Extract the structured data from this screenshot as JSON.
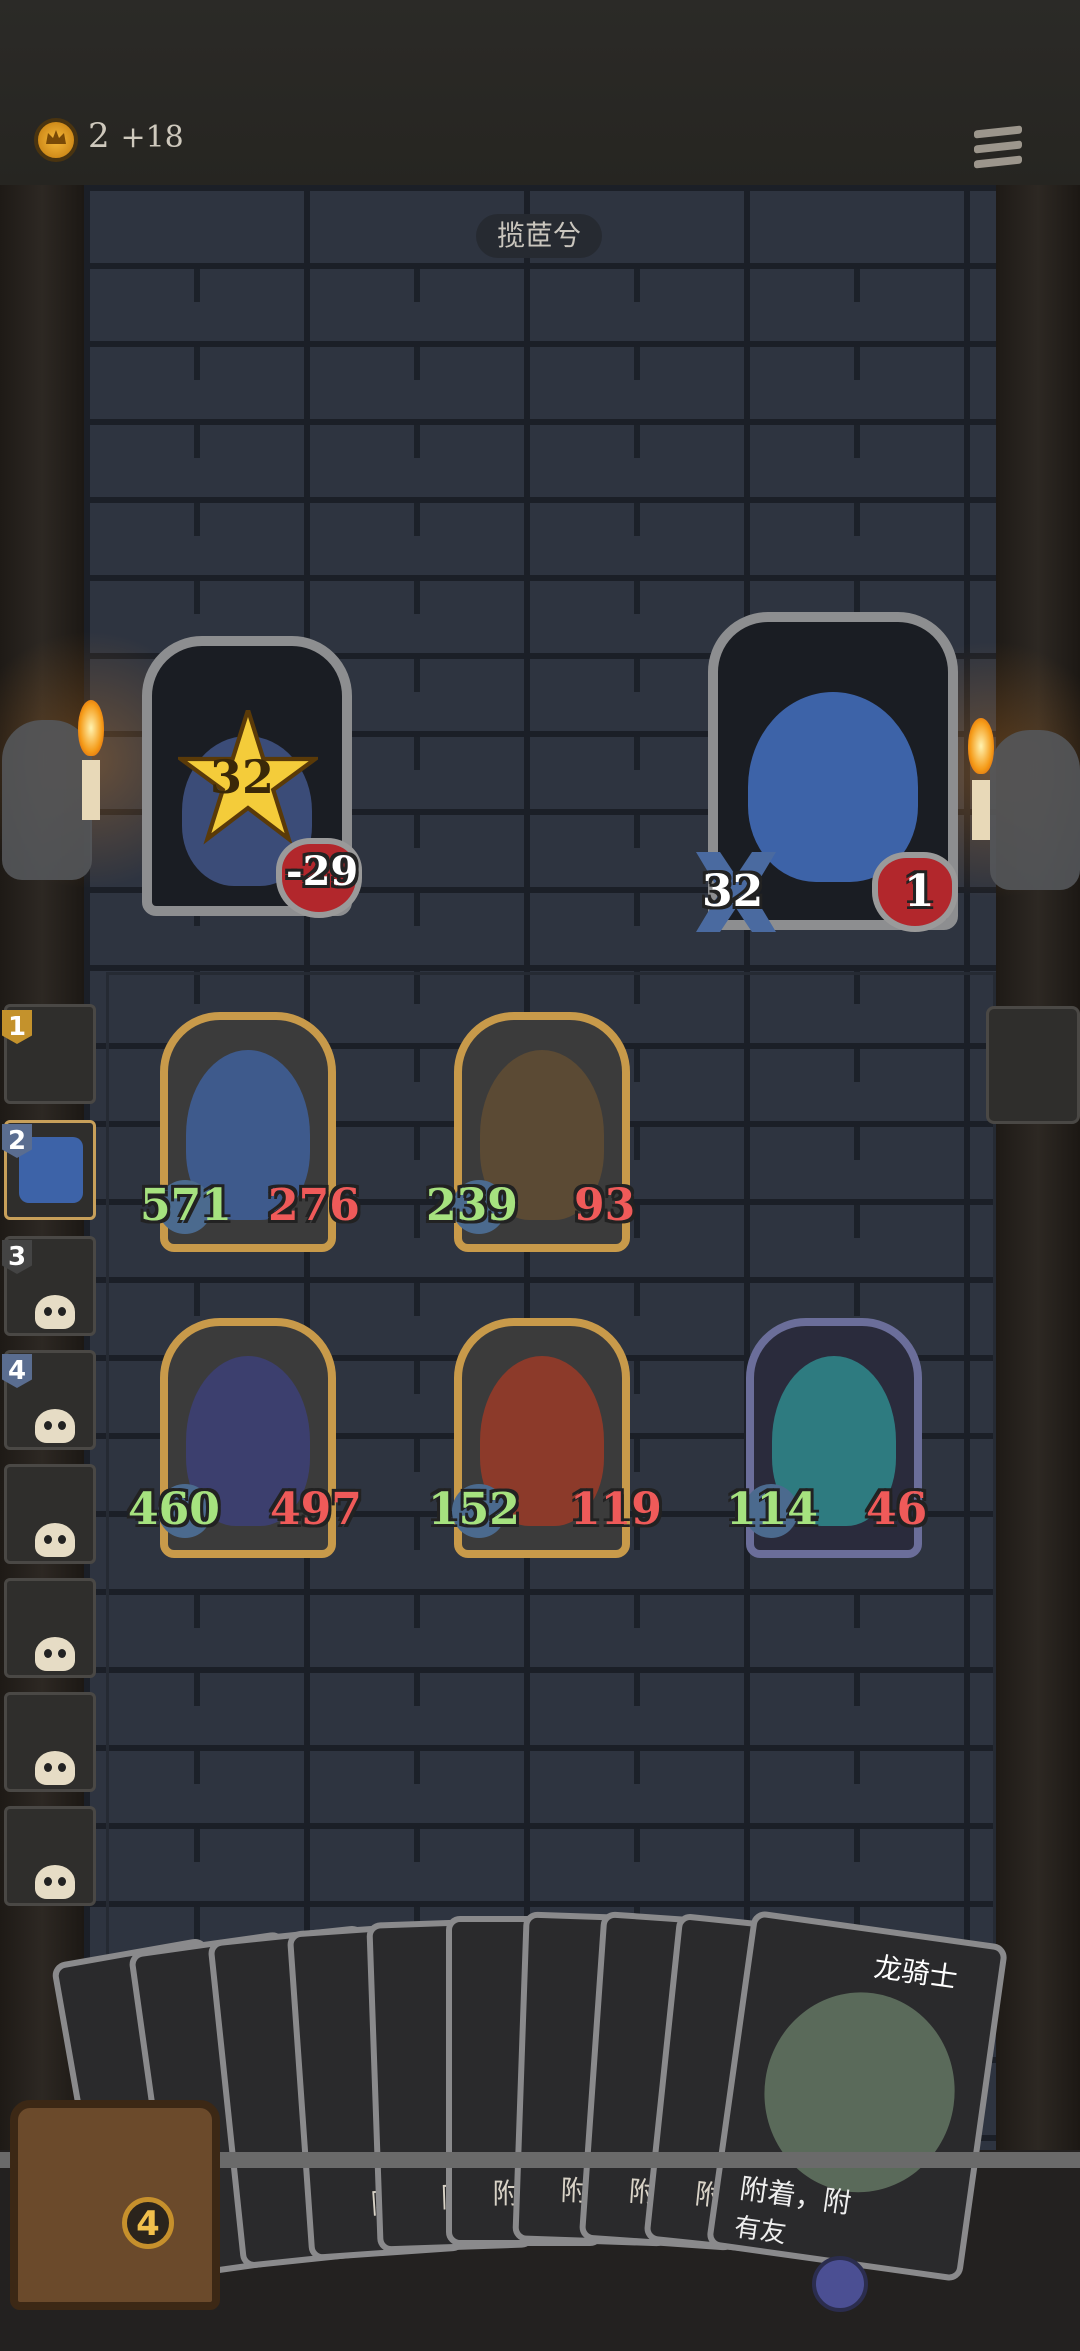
{
  "hud": {
    "gold": "2",
    "gold_income": "+18"
  },
  "location_name": "揽茝兮",
  "enemy_left": {
    "name_icon": "enemy-portrait-icon",
    "attack": "32",
    "hp": "-29"
  },
  "enemy_right": {
    "name_icon": "blue-beast-portrait-icon",
    "attack": "32",
    "hp": "1"
  },
  "allies": [
    {
      "icon": "wizard-portrait-icon",
      "attack": "571",
      "hp": "276"
    },
    {
      "icon": "goblin-portrait-icon",
      "attack": "239",
      "hp": "93"
    },
    {
      "icon": "knight-portrait-icon",
      "attack": "460",
      "hp": "497"
    },
    {
      "icon": "imp-portrait-icon",
      "attack": "152",
      "hp": "119"
    },
    {
      "icon": "ghost-portrait-icon",
      "attack": "114",
      "hp": "46"
    }
  ],
  "queue": [
    {
      "num": "1"
    },
    {
      "num": "2"
    },
    {
      "num": "3"
    },
    {
      "num": "4"
    },
    {
      "num": ""
    },
    {
      "num": ""
    },
    {
      "num": ""
    },
    {
      "num": ""
    }
  ],
  "hand": {
    "cards": [
      {
        "label": ""
      },
      {
        "label": ""
      },
      {
        "label": ""
      },
      {
        "label": "附"
      },
      {
        "label": "附"
      },
      {
        "label": "附 有"
      },
      {
        "label": "附 有"
      },
      {
        "label": "附 有"
      },
      {
        "label": "附 有"
      },
      {
        "label": "附 有"
      }
    ],
    "featured": {
      "title": "龙骑士",
      "text_line1": "附着，附",
      "text_line2": "有友"
    }
  },
  "deck_count": "4",
  "colors": {
    "attack": "#a6e27f",
    "hp": "#ef5a59",
    "gold_frame": "#c89a4a"
  }
}
